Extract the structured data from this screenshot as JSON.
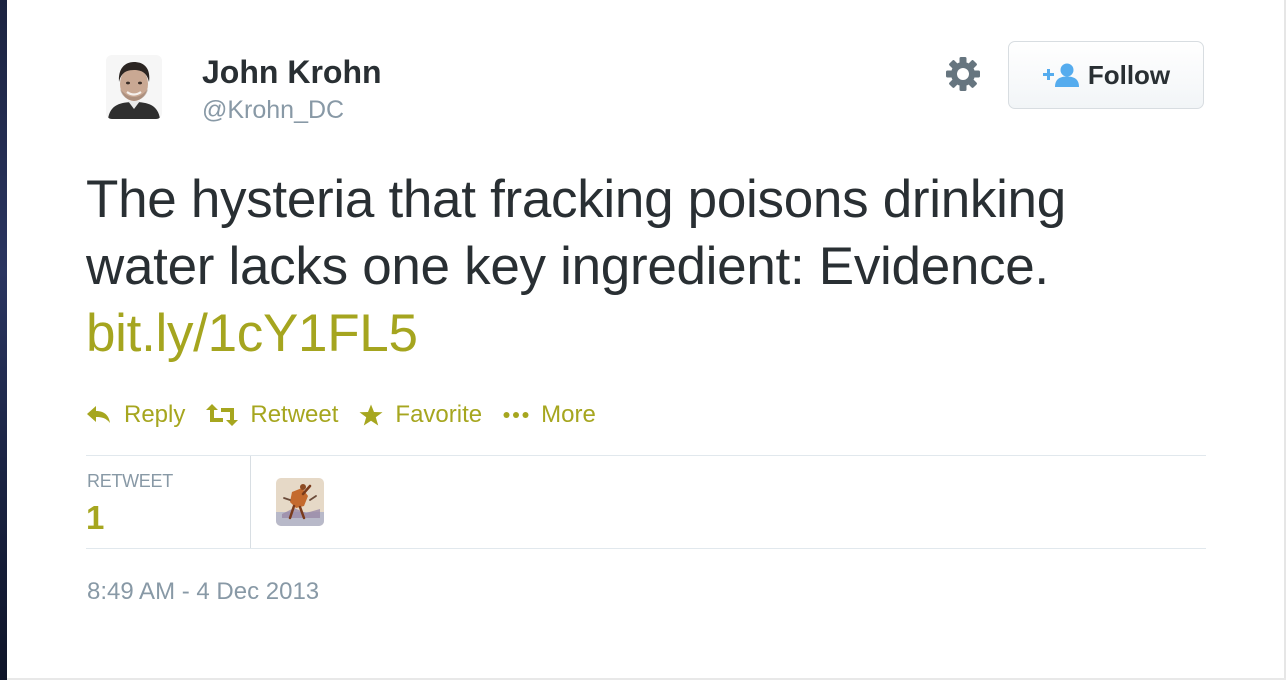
{
  "user": {
    "name": "John Krohn",
    "handle": "@Krohn_DC",
    "avatar_icon": "profile-photo"
  },
  "header": {
    "settings_icon": "gear-icon",
    "follow_label": "Follow",
    "follow_icon": "add-user-icon"
  },
  "tweet": {
    "text_line1": "The hysteria that fracking poisons drinking",
    "text_line2": "water lacks one key ingredient: Evidence.",
    "link": "bit.ly/1cY1FL5"
  },
  "actions": [
    {
      "label": "Reply",
      "icon": "reply-icon"
    },
    {
      "label": "Retweet",
      "icon": "retweet-icon"
    },
    {
      "label": "Favorite",
      "icon": "star-icon"
    },
    {
      "label": "More",
      "icon": "more-dots-icon"
    }
  ],
  "stats": {
    "retweet_label": "RETWEET",
    "retweet_count": "1",
    "retweeter_icon": "retweeter-avatar"
  },
  "timestamp": "8:49 AM - 4 Dec 2013",
  "colors": {
    "link_accent": "#a6a61f",
    "text_primary": "#292f33",
    "text_secondary": "#8899a6",
    "follow_icon_blue": "#55acee"
  }
}
